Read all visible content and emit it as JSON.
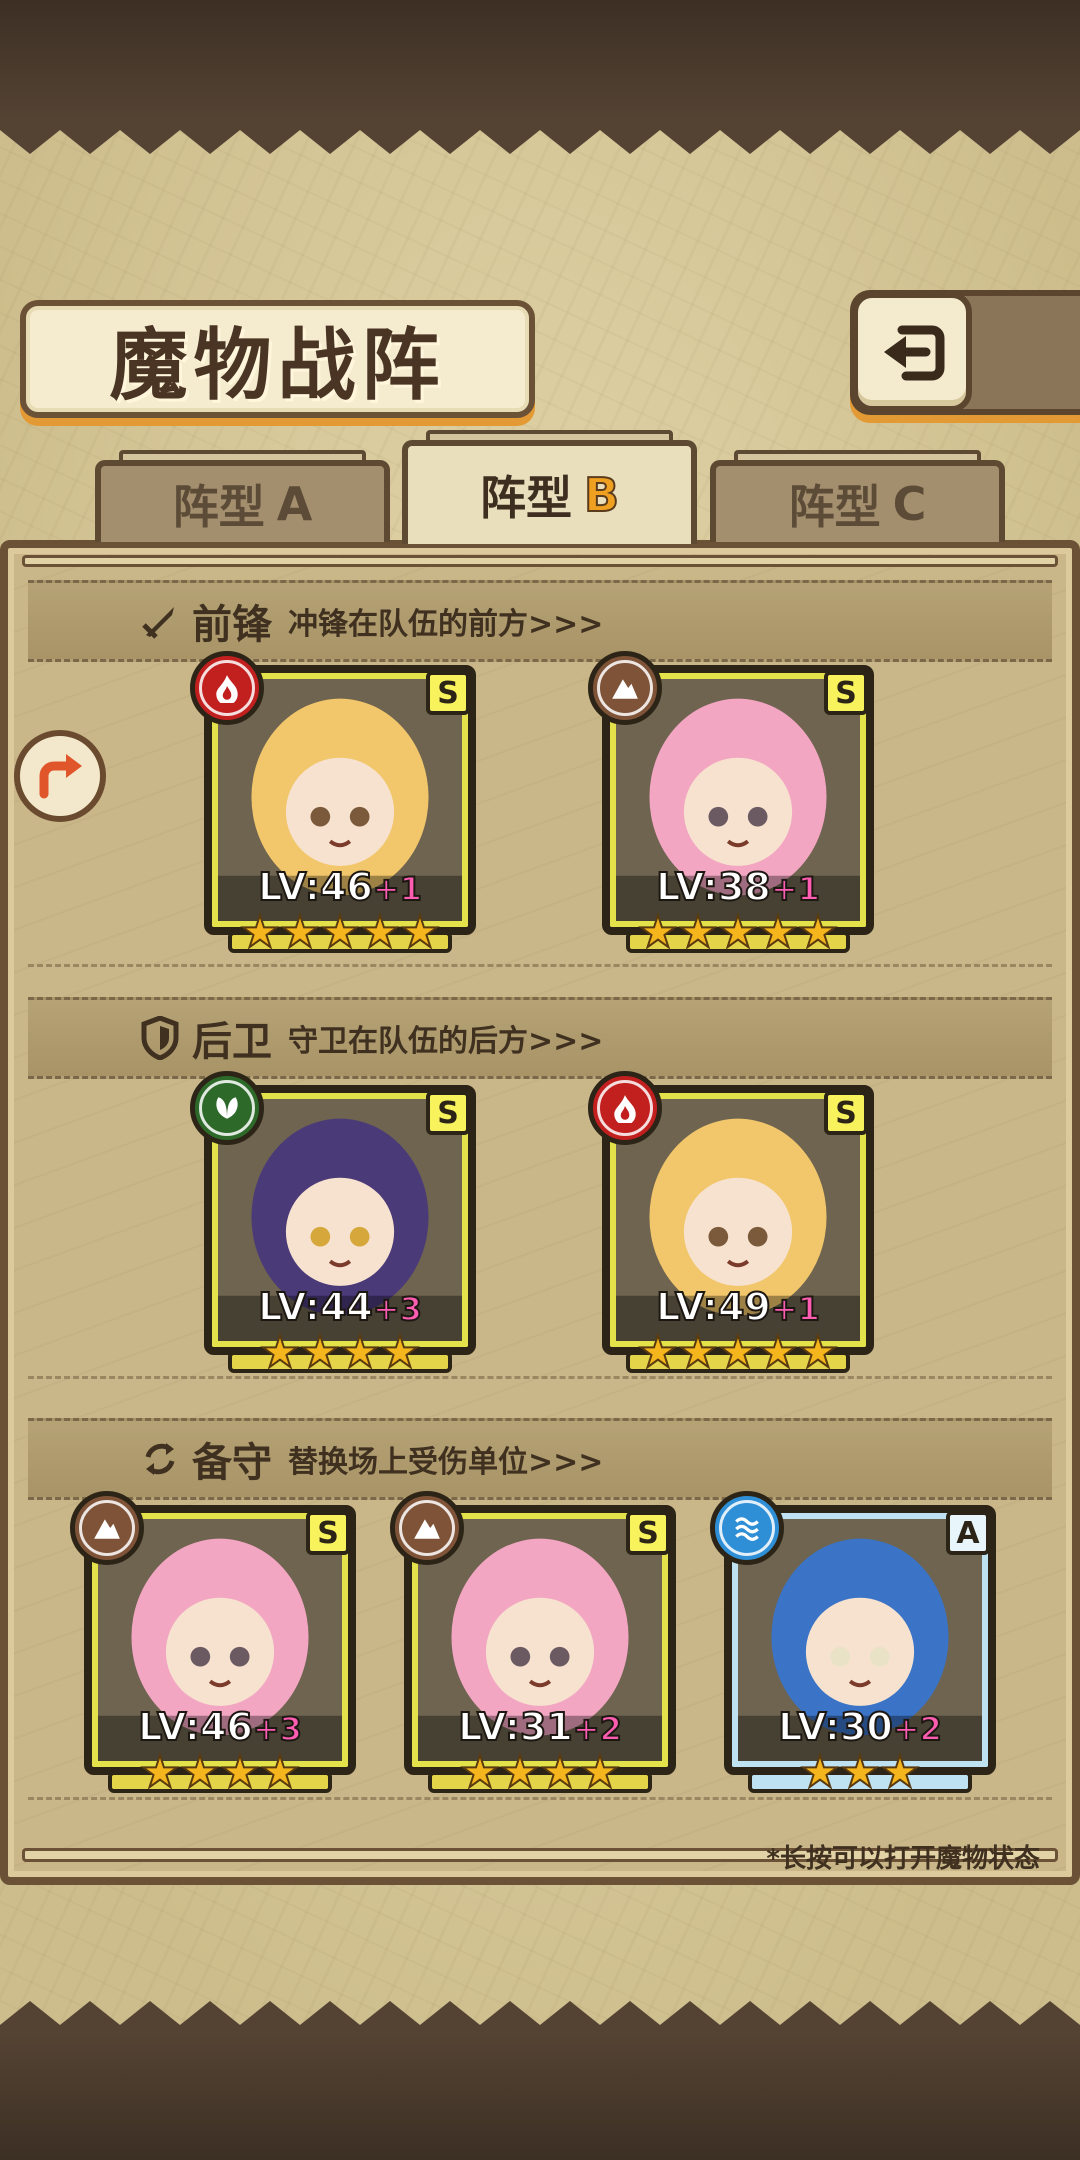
{
  "title": "魔物战阵",
  "tabs": [
    {
      "prefix": "阵型",
      "letter": "A",
      "active": false
    },
    {
      "prefix": "阵型",
      "letter": "B",
      "active": true
    },
    {
      "prefix": "阵型",
      "letter": "C",
      "active": false
    }
  ],
  "sections": {
    "vanguard": {
      "title": "前锋",
      "desc": "冲锋在队伍的前方>>>",
      "icon": "sword-icon"
    },
    "rearguard": {
      "title": "后卫",
      "desc": "守卫在队伍的后方>>>",
      "icon": "shield-icon"
    },
    "reserve": {
      "title": "备守",
      "desc": "替换场上受伤单位>>>",
      "icon": "swap-icon"
    }
  },
  "monsters": {
    "vanguard": [
      {
        "element": "fire",
        "rank": "S",
        "level": "LV:46",
        "plus": "+1",
        "stars": 5
      },
      {
        "element": "earth",
        "rank": "S",
        "level": "LV:38",
        "plus": "+1",
        "stars": 5
      }
    ],
    "rearguard": [
      {
        "element": "wood",
        "rank": "S",
        "level": "LV:44",
        "plus": "+3",
        "stars": 4
      },
      {
        "element": "fire",
        "rank": "S",
        "level": "LV:49",
        "plus": "+1",
        "stars": 5
      }
    ],
    "reserve": [
      {
        "element": "earth",
        "rank": "S",
        "level": "LV:46",
        "plus": "+3",
        "stars": 4
      },
      {
        "element": "earth",
        "rank": "S",
        "level": "LV:31",
        "plus": "+2",
        "stars": 4
      },
      {
        "element": "water",
        "rank": "A",
        "level": "LV:30",
        "plus": "+2",
        "stars": 3
      }
    ]
  },
  "star_glyph": "★",
  "hint": "*长按可以打开魔物状态",
  "colors": {
    "parchment": "#d9caa0",
    "frame": "#6b5236",
    "accent_orange": "#e39a35",
    "rank_s_border": "#e3e24a",
    "rank_a_border": "#bfe2f2",
    "level_plus": "#ff5db2"
  }
}
